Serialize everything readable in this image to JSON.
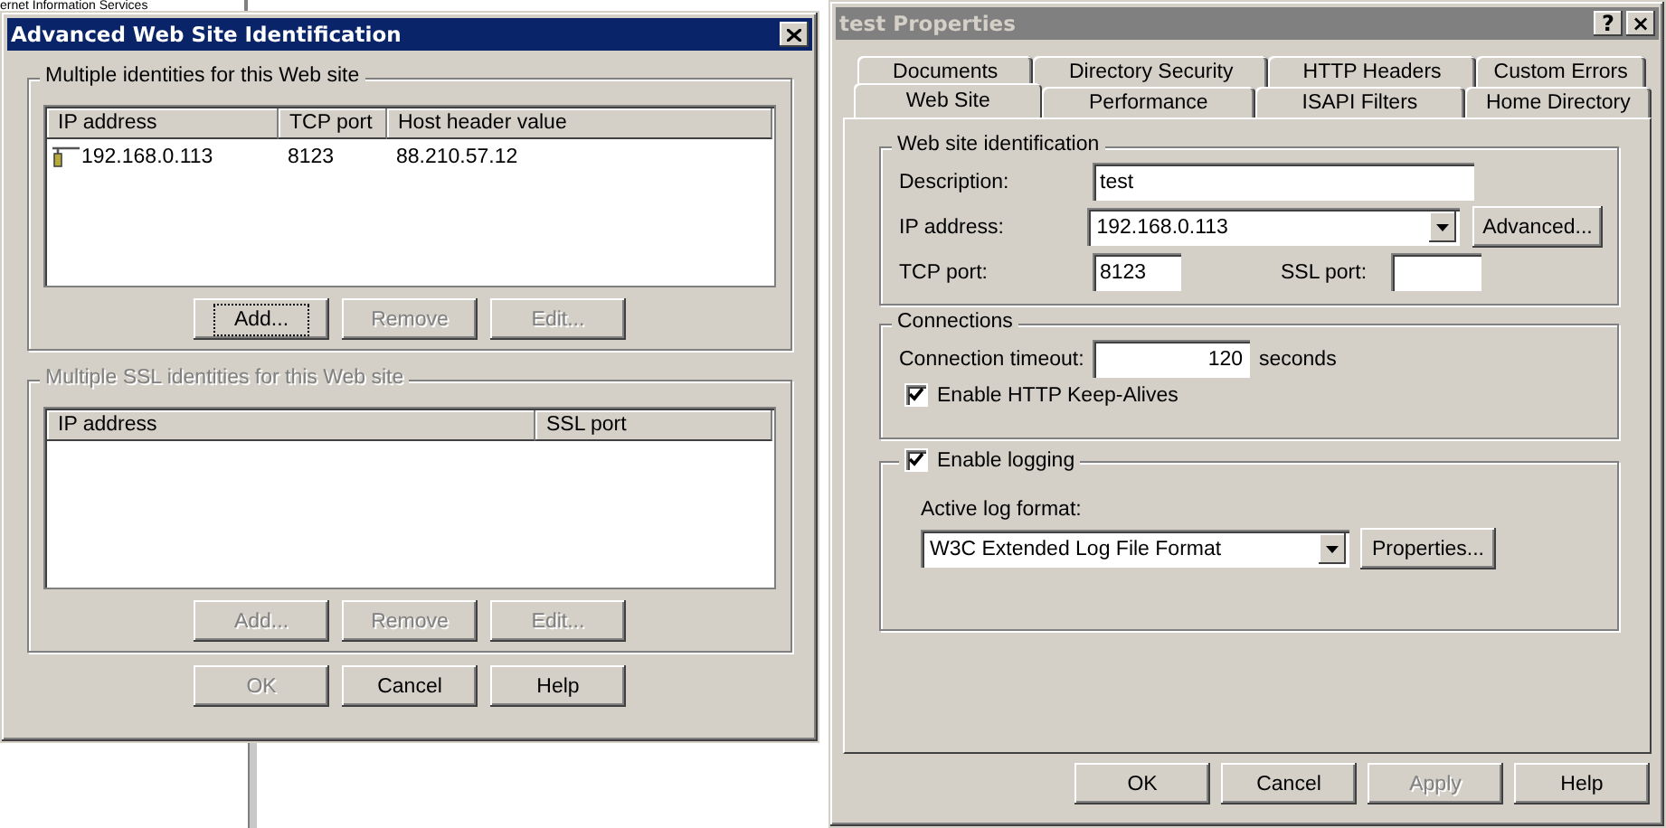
{
  "background_window": {
    "title": "ernet Information Services"
  },
  "advanced_dialog": {
    "title": "Advanced Web Site Identification",
    "active": true,
    "groups": [
      {
        "label": "Multiple identities for this Web site",
        "disabled": false,
        "columns": [
          "IP address",
          "TCP port",
          "Host header value"
        ],
        "rows": [
          [
            "192.168.0.113",
            "8123",
            "88.210.57.12"
          ]
        ],
        "buttons": [
          {
            "label": "Add...",
            "disabled": false,
            "focused": true
          },
          {
            "label": "Remove",
            "disabled": true,
            "focused": false
          },
          {
            "label": "Edit...",
            "disabled": true,
            "focused": false
          }
        ]
      },
      {
        "label": "Multiple SSL identities for this Web site",
        "disabled": true,
        "columns": [
          "IP address",
          "SSL port"
        ],
        "buttons": [
          {
            "label": "Add...",
            "disabled": true,
            "focused": false
          },
          {
            "label": "Remove",
            "disabled": true,
            "focused": false
          },
          {
            "label": "Edit...",
            "disabled": true,
            "focused": false
          }
        ]
      }
    ],
    "buttons": [
      {
        "label": "OK",
        "disabled": true
      },
      {
        "label": "Cancel",
        "disabled": false
      },
      {
        "label": "Help",
        "disabled": false
      }
    ]
  },
  "properties_dialog": {
    "title": "test Properties",
    "active": false,
    "help_button": "?",
    "close_button": "×",
    "tab_rows": [
      [
        {
          "label": "Documents",
          "selected": false
        },
        {
          "label": "Directory Security",
          "selected": false
        },
        {
          "label": "HTTP Headers",
          "selected": false
        },
        {
          "label": "Custom Errors",
          "selected": false
        }
      ],
      [
        {
          "label": "Web Site",
          "selected": true
        },
        {
          "label": "Performance",
          "selected": false
        },
        {
          "label": "ISAPI Filters",
          "selected": false
        },
        {
          "label": "Home Directory",
          "selected": false
        }
      ]
    ],
    "identification": {
      "title": "Web site identification",
      "description_label": "Description:",
      "description": "test",
      "ip_label": "IP address:",
      "ip": "192.168.0.113",
      "advanced_button": "Advanced...",
      "tcp_label": "TCP port:",
      "tcp_port": "8123",
      "ssl_label": "SSL port:"
    },
    "connections": {
      "title": "Connections",
      "timeout_label": "Connection timeout:",
      "timeout": "120",
      "unit": "seconds",
      "keep_alive": {
        "label": "Enable HTTP Keep-Alives",
        "checked": true
      }
    },
    "logging": {
      "label": "Enable logging",
      "checked": true,
      "format_label": "Active log format:",
      "format": "W3C Extended Log File Format",
      "properties_button": "Properties..."
    },
    "buttons": [
      {
        "label": "OK",
        "disabled": false
      },
      {
        "label": "Cancel",
        "disabled": false
      },
      {
        "label": "Apply",
        "disabled": true
      },
      {
        "label": "Help",
        "disabled": false
      }
    ]
  }
}
